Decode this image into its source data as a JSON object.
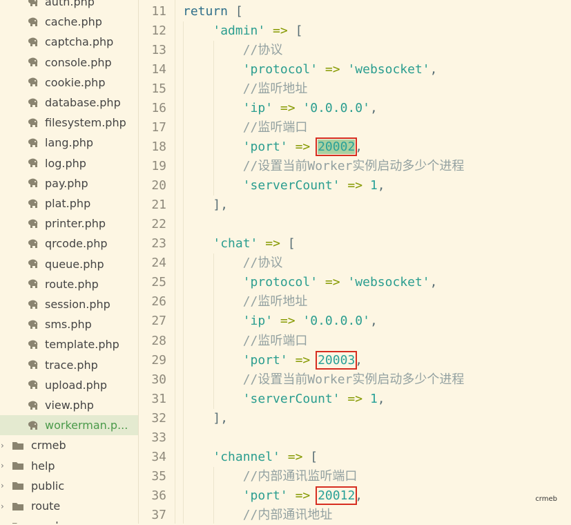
{
  "sidebar": {
    "files": [
      {
        "name": "auth.php",
        "selected": false
      },
      {
        "name": "cache.php",
        "selected": false
      },
      {
        "name": "captcha.php",
        "selected": false
      },
      {
        "name": "console.php",
        "selected": false
      },
      {
        "name": "cookie.php",
        "selected": false
      },
      {
        "name": "database.php",
        "selected": false
      },
      {
        "name": "filesystem.php",
        "selected": false
      },
      {
        "name": "lang.php",
        "selected": false
      },
      {
        "name": "log.php",
        "selected": false
      },
      {
        "name": "pay.php",
        "selected": false
      },
      {
        "name": "plat.php",
        "selected": false
      },
      {
        "name": "printer.php",
        "selected": false
      },
      {
        "name": "qrcode.php",
        "selected": false
      },
      {
        "name": "queue.php",
        "selected": false
      },
      {
        "name": "route.php",
        "selected": false
      },
      {
        "name": "session.php",
        "selected": false
      },
      {
        "name": "sms.php",
        "selected": false
      },
      {
        "name": "template.php",
        "selected": false
      },
      {
        "name": "trace.php",
        "selected": false
      },
      {
        "name": "upload.php",
        "selected": false
      },
      {
        "name": "view.php",
        "selected": false
      },
      {
        "name": "workerman.p...",
        "selected": true
      }
    ],
    "folders": [
      "crmeb",
      "help",
      "public",
      "route",
      "vendor"
    ]
  },
  "editor": {
    "lines": [
      {
        "n": "11",
        "tokens": [
          [
            "kw",
            "return "
          ],
          [
            "punc",
            "["
          ]
        ]
      },
      {
        "n": "12",
        "tokens": [
          [
            "ind",
            "    "
          ],
          [
            "str",
            "'admin'"
          ],
          [
            "op",
            " => "
          ],
          [
            "punc",
            "["
          ]
        ]
      },
      {
        "n": "13",
        "tokens": [
          [
            "ind",
            "        "
          ],
          [
            "cm",
            "//协议"
          ]
        ]
      },
      {
        "n": "14",
        "tokens": [
          [
            "ind",
            "        "
          ],
          [
            "str",
            "'protocol'"
          ],
          [
            "op",
            " => "
          ],
          [
            "str",
            "'websocket'"
          ],
          [
            "punc",
            ","
          ]
        ]
      },
      {
        "n": "15",
        "tokens": [
          [
            "ind",
            "        "
          ],
          [
            "cm",
            "//监听地址"
          ]
        ]
      },
      {
        "n": "16",
        "tokens": [
          [
            "ind",
            "        "
          ],
          [
            "str",
            "'ip'"
          ],
          [
            "op",
            " => "
          ],
          [
            "str",
            "'0.0.0.0'"
          ],
          [
            "punc",
            ","
          ]
        ]
      },
      {
        "n": "17",
        "tokens": [
          [
            "ind",
            "        "
          ],
          [
            "cm",
            "//监听端口"
          ]
        ]
      },
      {
        "n": "18",
        "tokens": [
          [
            "ind",
            "        "
          ],
          [
            "str",
            "'port'"
          ],
          [
            "op",
            " => "
          ],
          [
            "numsel",
            "20002"
          ],
          [
            "punc",
            ","
          ]
        ]
      },
      {
        "n": "19",
        "tokens": [
          [
            "ind",
            "        "
          ],
          [
            "cm",
            "//设置当前Worker实例启动多少个进程"
          ]
        ]
      },
      {
        "n": "20",
        "tokens": [
          [
            "ind",
            "        "
          ],
          [
            "str",
            "'serverCount'"
          ],
          [
            "op",
            " => "
          ],
          [
            "num",
            "1"
          ],
          [
            "punc",
            ","
          ]
        ]
      },
      {
        "n": "21",
        "tokens": [
          [
            "ind",
            "    "
          ],
          [
            "punc",
            "],"
          ]
        ]
      },
      {
        "n": "22",
        "tokens": []
      },
      {
        "n": "23",
        "tokens": [
          [
            "ind",
            "    "
          ],
          [
            "str",
            "'chat'"
          ],
          [
            "op",
            " => "
          ],
          [
            "punc",
            "["
          ]
        ]
      },
      {
        "n": "24",
        "tokens": [
          [
            "ind",
            "        "
          ],
          [
            "cm",
            "//协议"
          ]
        ]
      },
      {
        "n": "25",
        "tokens": [
          [
            "ind",
            "        "
          ],
          [
            "str",
            "'protocol'"
          ],
          [
            "op",
            " => "
          ],
          [
            "str",
            "'websocket'"
          ],
          [
            "punc",
            ","
          ]
        ]
      },
      {
        "n": "26",
        "tokens": [
          [
            "ind",
            "        "
          ],
          [
            "cm",
            "//监听地址"
          ]
        ]
      },
      {
        "n": "27",
        "tokens": [
          [
            "ind",
            "        "
          ],
          [
            "str",
            "'ip'"
          ],
          [
            "op",
            " => "
          ],
          [
            "str",
            "'0.0.0.0'"
          ],
          [
            "punc",
            ","
          ]
        ]
      },
      {
        "n": "28",
        "tokens": [
          [
            "ind",
            "        "
          ],
          [
            "cm",
            "//监听端口"
          ]
        ]
      },
      {
        "n": "29",
        "tokens": [
          [
            "ind",
            "        "
          ],
          [
            "str",
            "'port'"
          ],
          [
            "op",
            " => "
          ],
          [
            "numhl",
            "20003"
          ],
          [
            "punc",
            ","
          ]
        ]
      },
      {
        "n": "30",
        "tokens": [
          [
            "ind",
            "        "
          ],
          [
            "cm",
            "//设置当前Worker实例启动多少个进程"
          ]
        ]
      },
      {
        "n": "31",
        "tokens": [
          [
            "ind",
            "        "
          ],
          [
            "str",
            "'serverCount'"
          ],
          [
            "op",
            " => "
          ],
          [
            "num",
            "1"
          ],
          [
            "punc",
            ","
          ]
        ]
      },
      {
        "n": "32",
        "tokens": [
          [
            "ind",
            "    "
          ],
          [
            "punc",
            "],"
          ]
        ]
      },
      {
        "n": "33",
        "tokens": []
      },
      {
        "n": "34",
        "tokens": [
          [
            "ind",
            "    "
          ],
          [
            "str",
            "'channel'"
          ],
          [
            "op",
            " => "
          ],
          [
            "punc",
            "["
          ]
        ]
      },
      {
        "n": "35",
        "tokens": [
          [
            "ind",
            "        "
          ],
          [
            "cm",
            "//内部通讯监听端口"
          ]
        ]
      },
      {
        "n": "36",
        "tokens": [
          [
            "ind",
            "        "
          ],
          [
            "str",
            "'port'"
          ],
          [
            "op",
            " => "
          ],
          [
            "numhl",
            "20012"
          ],
          [
            "punc",
            ","
          ]
        ]
      },
      {
        "n": "37",
        "tokens": [
          [
            "ind",
            "        "
          ],
          [
            "cm",
            "//内部通讯地址"
          ]
        ]
      }
    ]
  },
  "watermark": "crmeb",
  "colors": {
    "background": "#fdf6e3",
    "highlight_box": "#d62d20",
    "selection": "#a8d0a0"
  },
  "icons": {
    "file": "php-elephant-icon",
    "folder": "folder-icon",
    "collapsed": "chevron-right-icon"
  }
}
